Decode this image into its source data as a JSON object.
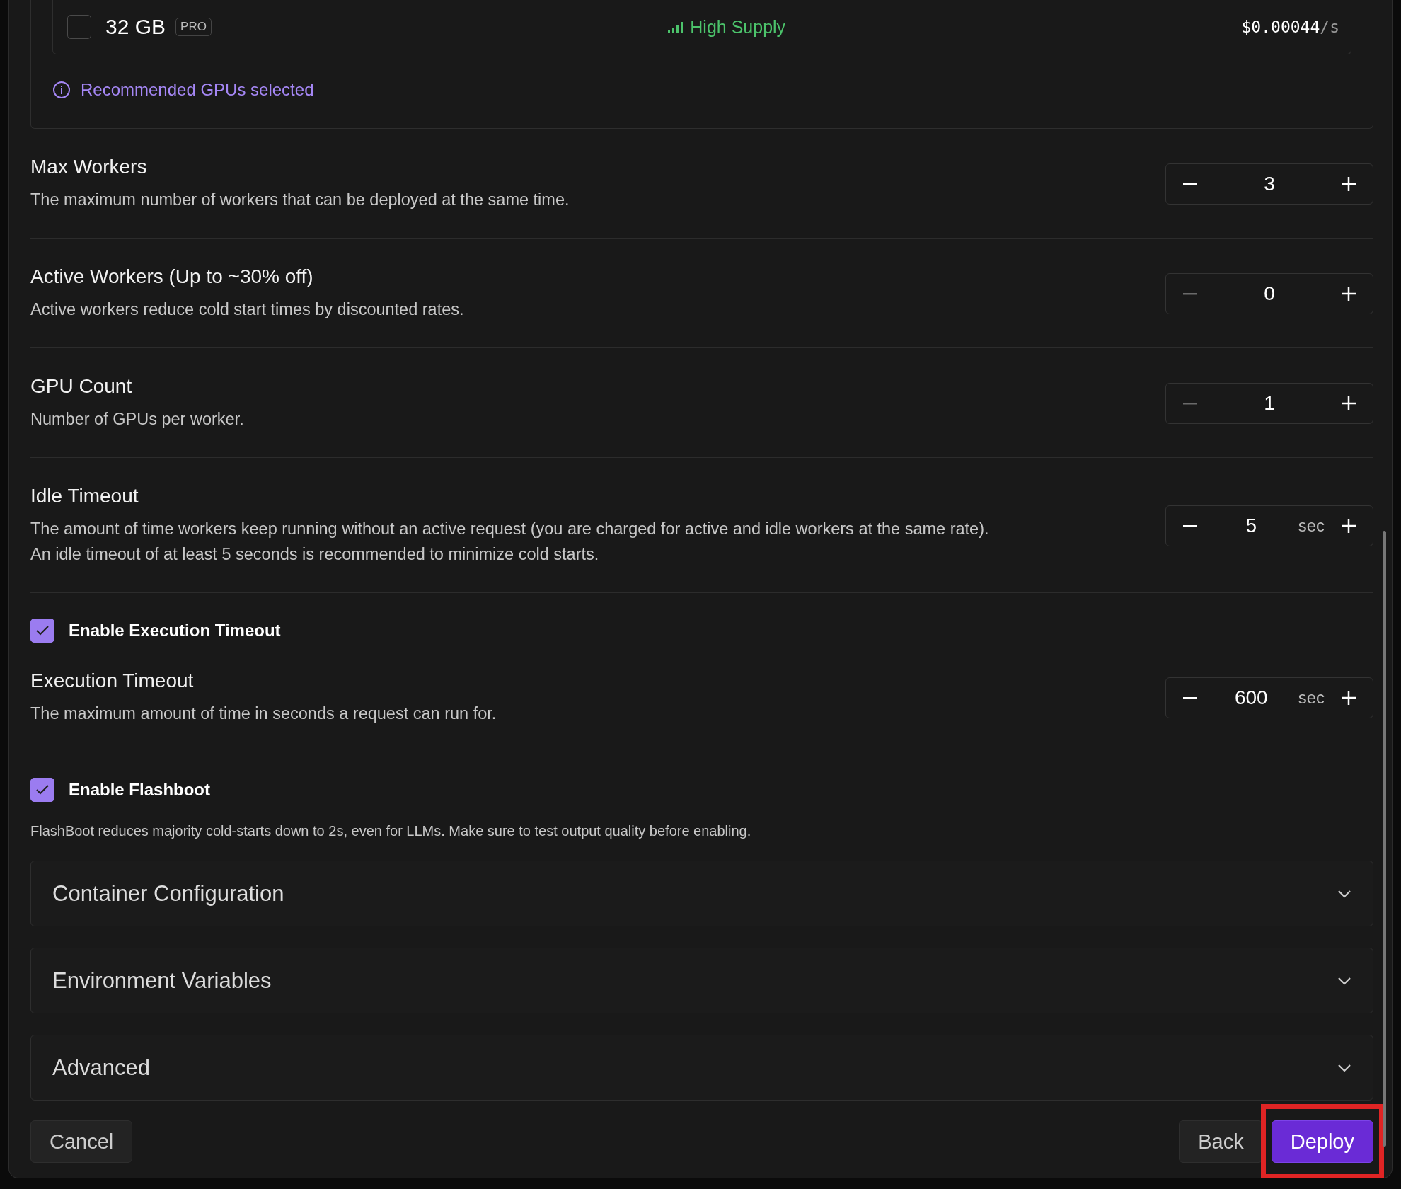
{
  "gpu_option": {
    "memory": "32 GB",
    "tier": "PRO",
    "checked": false,
    "supply": "High Supply",
    "price": "$0.00044",
    "price_unit": "/s"
  },
  "recommendation": "Recommended GPUs selected",
  "settings": [
    {
      "kind": "stepper",
      "title": "Max Workers",
      "description": "The maximum number of workers that can be deployed at the same time.",
      "value": "3",
      "minus_disabled": false
    },
    {
      "kind": "stepper",
      "title": "Active Workers (Up to ~30% off)",
      "description": "Active workers reduce cold start times by discounted rates.",
      "value": "0",
      "minus_disabled": true
    },
    {
      "kind": "stepper",
      "title": "GPU Count",
      "description": "Number of GPUs per worker.",
      "value": "1",
      "minus_disabled": true
    },
    {
      "kind": "stepper",
      "title": "Idle Timeout",
      "description": "The amount of time workers keep running without an active request (you are charged for active and idle workers at the same rate).\nAn idle timeout of at least 5 seconds is recommended to minimize cold starts.",
      "value": "5",
      "unit": "sec",
      "minus_disabled": false
    },
    {
      "kind": "checkbox",
      "label": "Enable Execution Timeout",
      "checked": true
    },
    {
      "kind": "stepper",
      "title": "Execution Timeout",
      "description": "The maximum amount of time in seconds a request can run for.",
      "value": "600",
      "unit": "sec",
      "minus_disabled": false
    },
    {
      "kind": "checkbox",
      "label": "Enable Flashboot",
      "checked": true,
      "note": "FlashBoot reduces majority cold-starts down to 2s, even for LLMs. Make sure to test output quality before enabling."
    }
  ],
  "sections": [
    {
      "title": "Container Configuration",
      "expanded": false
    },
    {
      "title": "Environment Variables",
      "expanded": false
    },
    {
      "title": "Advanced",
      "expanded": false
    }
  ],
  "buttons": [
    {
      "label": "Cancel",
      "kind": "secondary",
      "highlighted": false
    },
    {
      "label": "Back",
      "kind": "secondary",
      "highlighted": false
    },
    {
      "label": "Deploy",
      "kind": "primary",
      "highlighted": true
    }
  ]
}
